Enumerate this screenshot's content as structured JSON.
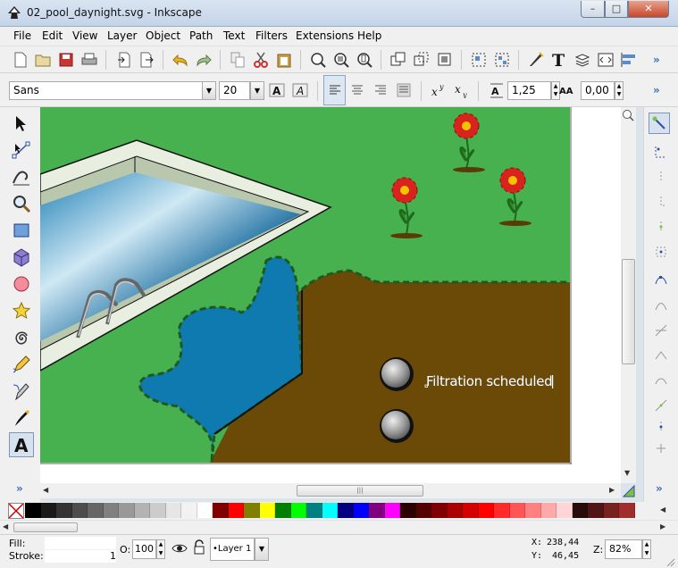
{
  "window": {
    "title": "02_pool_daynight.svg - Inkscape",
    "minimize_icon": "minimize-icon",
    "maximize_icon": "maximize-icon",
    "close_icon": "close-icon"
  },
  "menu": [
    "File",
    "Edit",
    "View",
    "Layer",
    "Object",
    "Path",
    "Text",
    "Filters",
    "Extensions",
    "Help"
  ],
  "text_toolbar": {
    "font_family": "Sans",
    "font_size": "20",
    "line_spacing": "1,25",
    "letter_spacing": "0,00"
  },
  "canvas": {
    "text_object": "Filtration scheduled",
    "colors": {
      "grass": "#47b04f",
      "soil": "#6b4a08",
      "water": "#0f7ab0",
      "pool_rim": "#e8eee0",
      "flower": "#d8241c"
    }
  },
  "palette": [
    "#000000",
    "#1a1a1a",
    "#333333",
    "#4d4d4d",
    "#666666",
    "#808080",
    "#999999",
    "#b3b3b3",
    "#cccccc",
    "#e6e6e6",
    "#f2f2f2",
    "#ffffff",
    "#800000",
    "#ff0000",
    "#808000",
    "#ffff00",
    "#008000",
    "#00ff00",
    "#008080",
    "#00ffff",
    "#000080",
    "#0000ff",
    "#800080",
    "#ff00ff",
    "#2b0000",
    "#550000",
    "#800000",
    "#aa0000",
    "#d40000",
    "#ff0000",
    "#ff2a2a",
    "#ff5555",
    "#ff8080",
    "#ffaaaa",
    "#ffd5d5",
    "#280b0b",
    "#501616",
    "#782121",
    "#a02c2c"
  ],
  "status": {
    "fill_label": "Fill:",
    "stroke_label": "Stroke:",
    "stroke_value": "1",
    "opacity_label": "O:",
    "opacity_value": "100",
    "layer": "Layer 1",
    "x_label": "X:",
    "x_value": "238,44",
    "y_label": "Y:",
    "y_value": "46,45",
    "zoom_label": "Z:",
    "zoom_value": "82%"
  }
}
